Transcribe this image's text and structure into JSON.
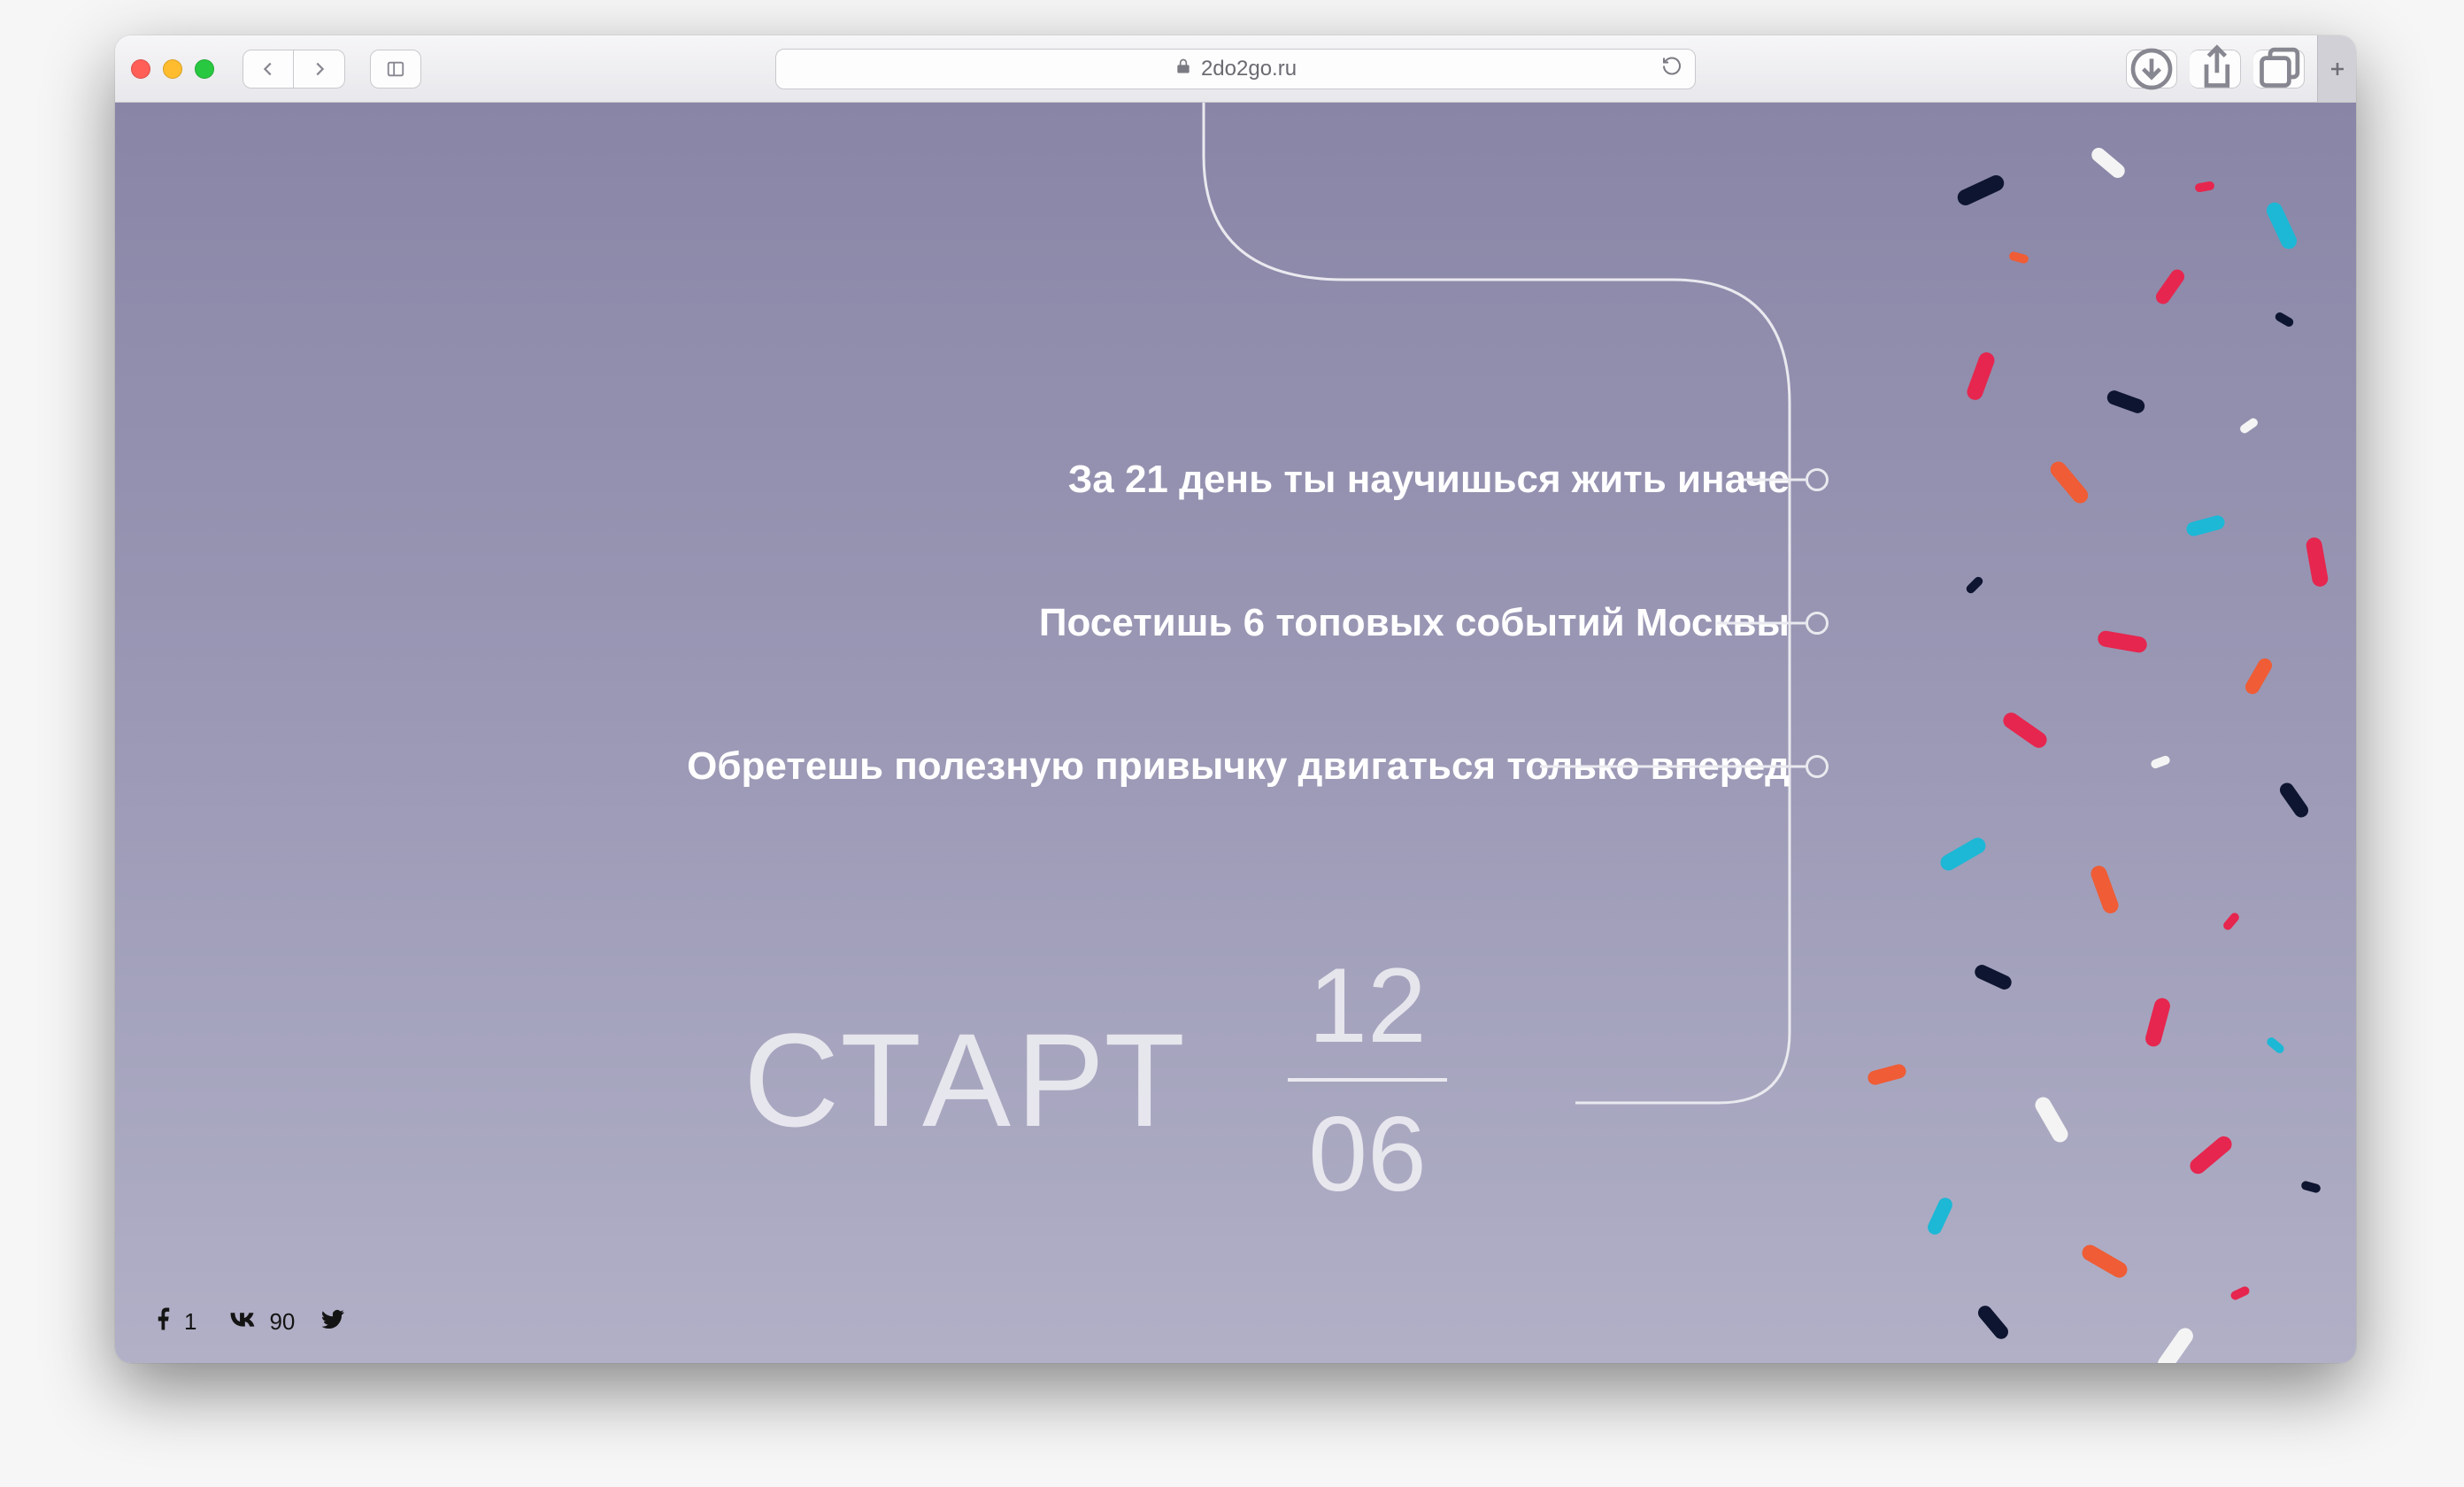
{
  "browser": {
    "url_display": "2do2go.ru"
  },
  "page": {
    "bullets": [
      "За 21 день ты научишься жить иначе",
      "Посетишь 6 топовых событий Москвы",
      "Обретешь полезную привычку двигаться только вперед"
    ],
    "start_label": "СТАРТ",
    "start_day": "12",
    "start_month": "06"
  },
  "social": {
    "facebook_count": "1",
    "vk_count": "90"
  },
  "colors": {
    "page_bg_top": "#8985a7",
    "page_bg_bottom": "#b1b0c7",
    "line": "#e9e9ef",
    "text_white": "#ffffff",
    "confetti": [
      "#e6264e",
      "#ef5c35",
      "#1cb8d6",
      "#0e1530",
      "#f4f4f4"
    ]
  }
}
